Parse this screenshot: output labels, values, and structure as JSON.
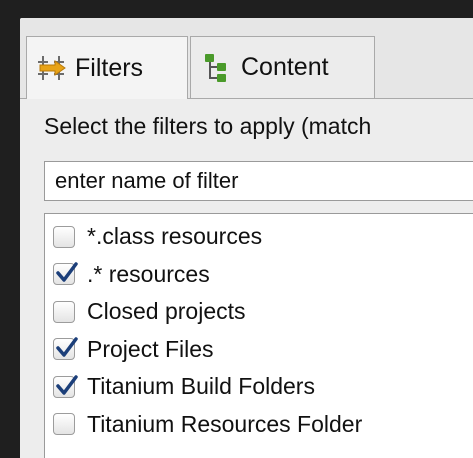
{
  "tabs": [
    {
      "label": "Filters",
      "icon": "filters-icon",
      "active": true
    },
    {
      "label": "Content",
      "icon": "content-tree-icon",
      "active": false
    }
  ],
  "instruction": "Select the filters to apply (match",
  "filter_input": {
    "value": "",
    "placeholder": "enter name of filter"
  },
  "filters": [
    {
      "label": "*.class resources",
      "checked": false
    },
    {
      "label": ".* resources",
      "checked": true
    },
    {
      "label": "Closed projects",
      "checked": false
    },
    {
      "label": "Project Files",
      "checked": true
    },
    {
      "label": "Titanium Build Folders",
      "checked": true
    },
    {
      "label": "Titanium Resources Folder",
      "checked": false
    }
  ],
  "colors": {
    "background": "#1f1f1f",
    "panel": "#ededed",
    "checkmark": "#1c3f7a",
    "filters_icon_arrow": "#e8a317",
    "content_icon_green": "#4a9a2a"
  }
}
